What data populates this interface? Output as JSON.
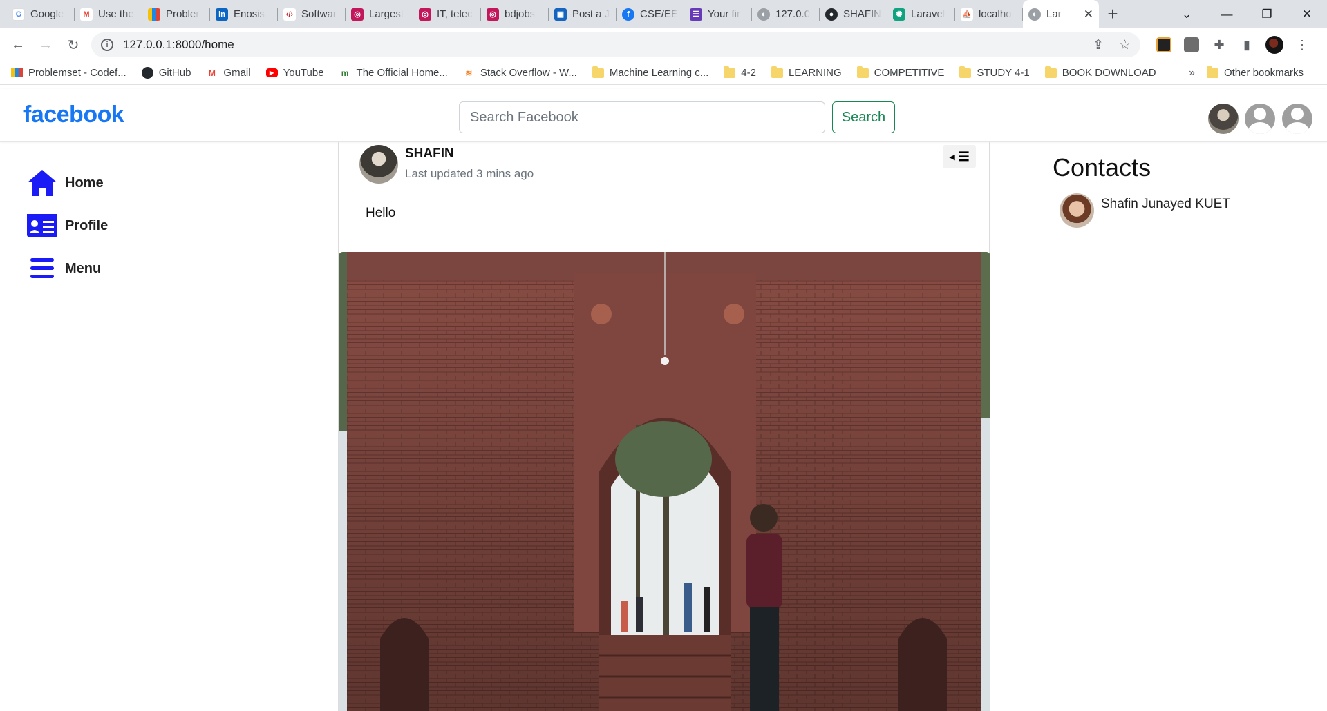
{
  "browser": {
    "tabs": [
      {
        "title": "Google",
        "favicon": "google-icon",
        "color": "#4285f4"
      },
      {
        "title": "Use the",
        "favicon": "gmail-icon",
        "color": "#ea4335"
      },
      {
        "title": "Probler",
        "favicon": "codeforces-icon",
        "color": "#1e88e5"
      },
      {
        "title": "Enosis",
        "favicon": "linkedin-icon",
        "color": "#0a66c2"
      },
      {
        "title": "Softwar",
        "favicon": "code-icon",
        "color": "#c62828"
      },
      {
        "title": "Largest",
        "favicon": "camera-icon",
        "color": "#c2185b"
      },
      {
        "title": "IT, telec",
        "favicon": "camera-icon",
        "color": "#c2185b"
      },
      {
        "title": "bdjobs",
        "favicon": "camera-icon",
        "color": "#c2185b"
      },
      {
        "title": "Post a J",
        "favicon": "chat-icon",
        "color": "#1565c0"
      },
      {
        "title": "CSE/EE",
        "favicon": "facebook-icon",
        "color": "#1877f2"
      },
      {
        "title": "Your fir",
        "favicon": "form-icon",
        "color": "#673ab7"
      },
      {
        "title": "127.0.0",
        "favicon": "globe-icon",
        "color": "#5f6368"
      },
      {
        "title": "SHAFIN",
        "favicon": "github-icon",
        "color": "#24292e"
      },
      {
        "title": "Laravel",
        "favicon": "openai-icon",
        "color": "#10a37f"
      },
      {
        "title": "localho",
        "favicon": "pma-icon",
        "color": "#e68a00"
      }
    ],
    "active_tab": {
      "title": "Lar",
      "favicon": "globe-icon",
      "color": "#5f6368"
    },
    "url": "127.0.0.1:8000/home",
    "bookmarks": [
      {
        "label": "Problemset - Codef...",
        "icon": "codeforces-icon"
      },
      {
        "label": "GitHub",
        "icon": "github-icon"
      },
      {
        "label": "Gmail",
        "icon": "gmail-icon"
      },
      {
        "label": "YouTube",
        "icon": "youtube-icon"
      },
      {
        "label": "The Official Home...",
        "icon": "site-icon"
      },
      {
        "label": "Stack Overflow - W...",
        "icon": "stackoverflow-icon"
      },
      {
        "label": "Machine Learning c...",
        "icon": "folder-icon"
      },
      {
        "label": "4-2",
        "icon": "folder-icon"
      },
      {
        "label": "LEARNING",
        "icon": "folder-icon"
      },
      {
        "label": "COMPETITIVE",
        "icon": "folder-icon"
      },
      {
        "label": "STUDY 4-1",
        "icon": "folder-icon"
      },
      {
        "label": "BOOK DOWNLOAD",
        "icon": "folder-icon"
      }
    ],
    "bookmarks_more": "»",
    "other_bookmarks": "Other bookmarks"
  },
  "app": {
    "logo": "facebook",
    "search": {
      "placeholder": "Search Facebook",
      "value": "",
      "button_label": "Search"
    },
    "nav": [
      {
        "label": "Home",
        "icon": "home-icon"
      },
      {
        "label": "Profile",
        "icon": "id-card-icon"
      },
      {
        "label": "Menu",
        "icon": "menu-icon"
      }
    ],
    "post": {
      "author": "SHAFIN",
      "time": "Last updated 3 mins ago",
      "text": "Hello",
      "image_alt": "photo"
    },
    "contacts": {
      "title": "Contacts",
      "items": [
        {
          "name": "Shafin Junayed KUET"
        }
      ]
    }
  },
  "colors": {
    "brand": "#1877f2",
    "search_button": "#198754",
    "nav_icon": "#1b1bf5"
  }
}
